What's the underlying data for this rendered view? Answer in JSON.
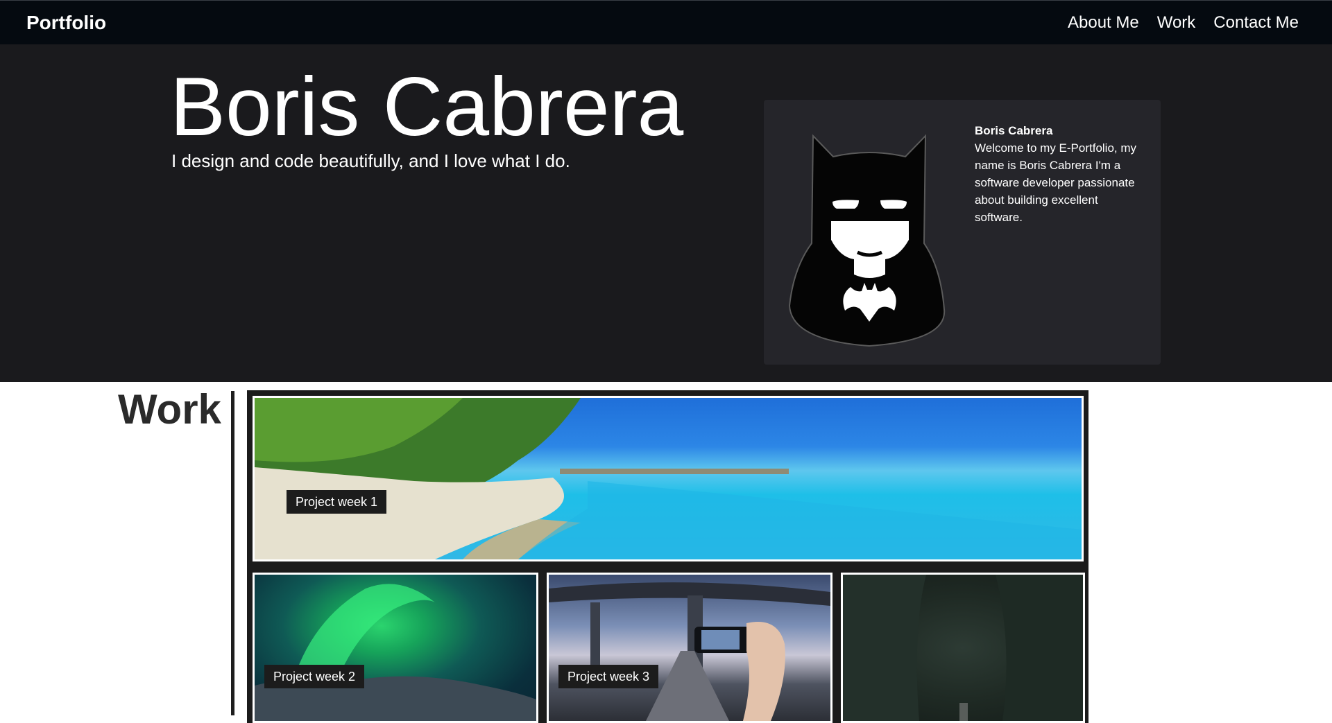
{
  "nav": {
    "brand": "Portfolio",
    "links": [
      "About Me",
      "Work",
      "Contact Me"
    ]
  },
  "hero": {
    "name": "Boris Cabrera",
    "tagline": "I design and code beautifully, and I love what I do."
  },
  "profile": {
    "name": "Boris Cabrera",
    "bio": "Welcome to my E-Portfolio, my name is Boris Cabrera I'm a software developer passionate about building excellent software.",
    "avatar_icon": "batman-avatar-icon"
  },
  "work": {
    "title": "Work",
    "projects": [
      {
        "label": "Project week 1"
      },
      {
        "label": "Project week 2"
      },
      {
        "label": "Project week 3"
      },
      {
        "label": ""
      }
    ]
  },
  "colors": {
    "navbar": "#050a10",
    "hero_bg": "#1a1a1d",
    "card_bg": "#25252a",
    "gallery_bg": "#1b1b1b"
  }
}
